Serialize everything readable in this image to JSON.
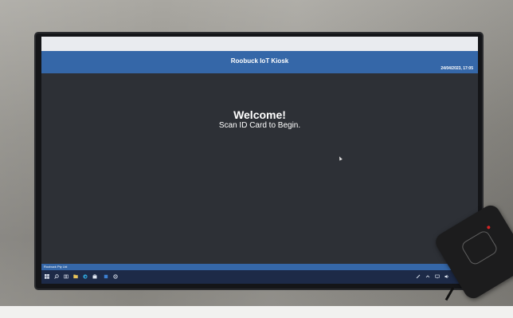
{
  "header": {
    "title": "Roobuck IoT Kiosk",
    "datetime": "24/04/2023, 17:05"
  },
  "main": {
    "welcome": "Welcome!",
    "instruction": "Scan ID Card to Begin."
  },
  "status_bar": {
    "text": "Roobuck Pty Ltd"
  },
  "taskbar": {
    "left_icons": [
      "windows-start-icon",
      "search-icon",
      "task-view-icon",
      "file-explorer-icon",
      "edge-browser-icon",
      "store-icon",
      "app-icon",
      "settings-icon"
    ],
    "tray_icons": [
      "pen-icon",
      "chevron-up-icon",
      "network-icon",
      "volume-icon"
    ]
  },
  "colors": {
    "header_blue": "#3567a8",
    "screen_bg": "#2d3036",
    "taskbar": "#1d2a47"
  }
}
